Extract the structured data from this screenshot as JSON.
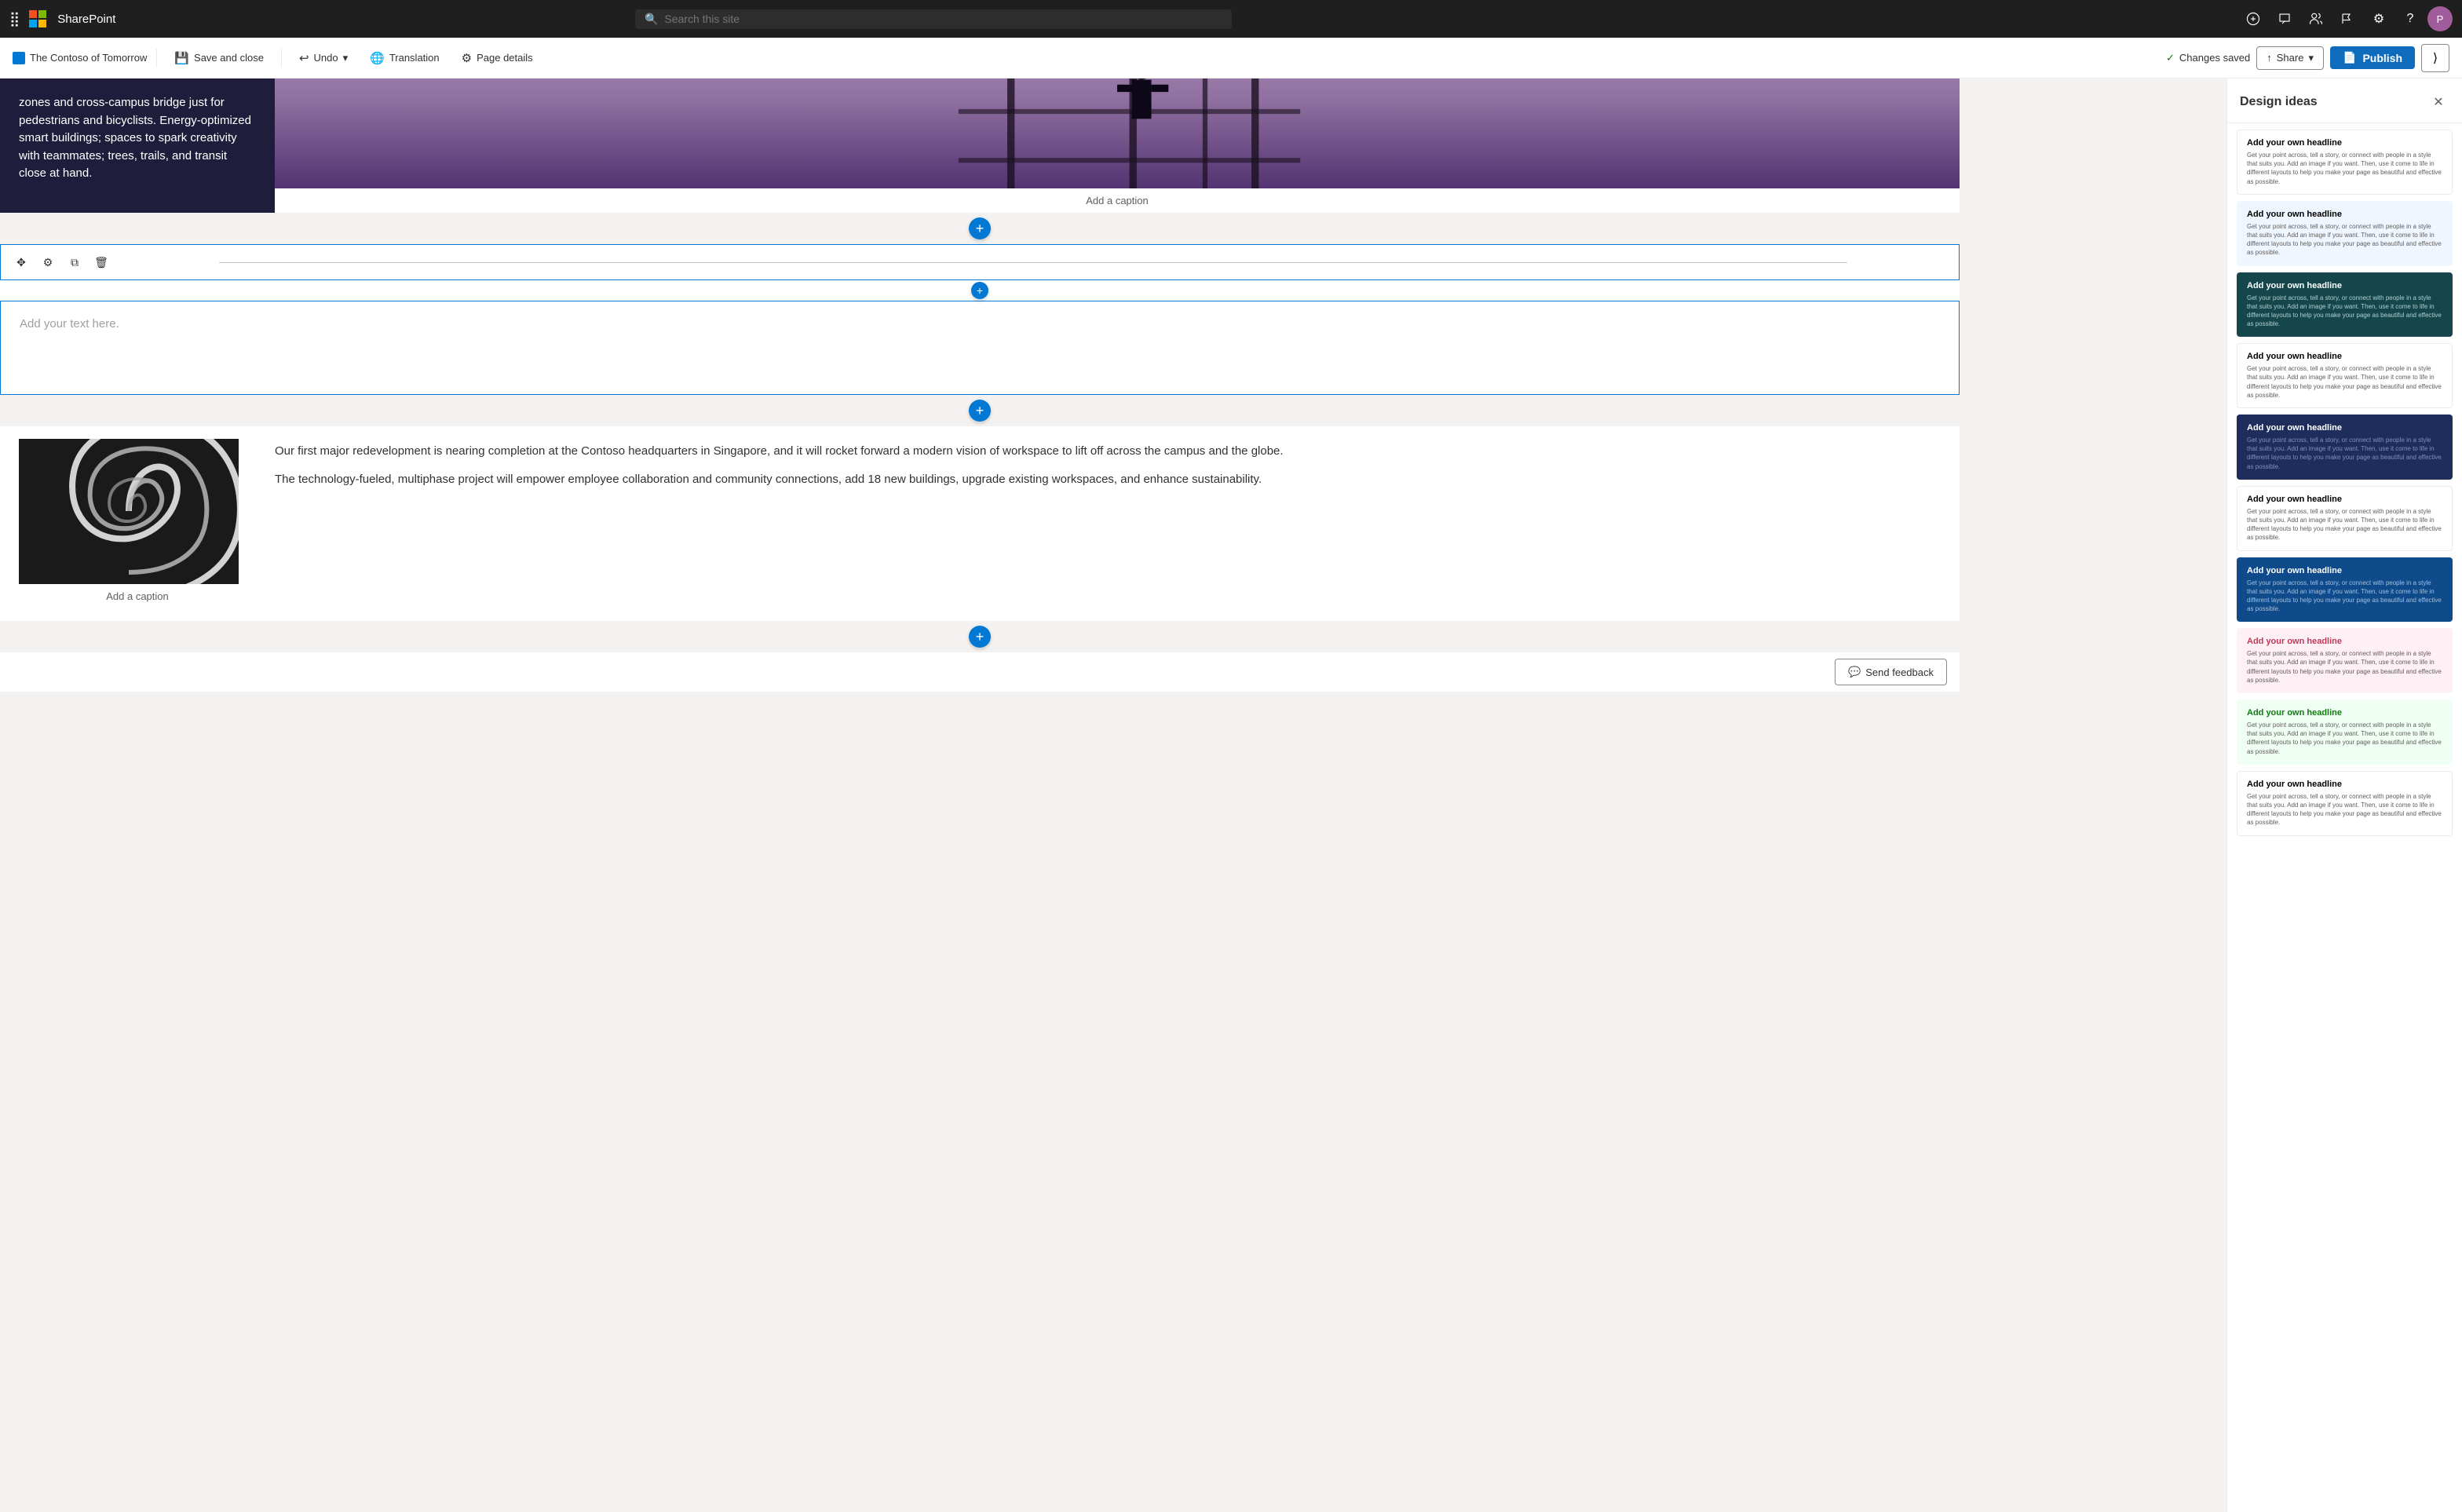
{
  "topnav": {
    "app_title": "SharePoint",
    "search_placeholder": "Search this site"
  },
  "toolbar": {
    "site_name": "The Contoso of Tomorrow",
    "save_close_label": "Save and close",
    "undo_label": "Undo",
    "translation_label": "Translation",
    "page_details_label": "Page details",
    "changes_saved_label": "Changes saved",
    "share_label": "Share",
    "publish_label": "Publish"
  },
  "design_panel": {
    "title": "Design ideas",
    "cards": [
      {
        "id": 1,
        "style": "style-white",
        "title": "Add your own headline",
        "text": "Get your point across, tell a story, or connect with people in a style that suits you. Add an image if you want. Then, use it come to life in different layouts to help you make your page as beautiful and effective as possible."
      },
      {
        "id": 2,
        "style": "style-light-blue",
        "title": "Add your own headline",
        "text": "Get your point across, tell a story, or connect with people in a style that suits you. Add an image if you want. Then, use it come to life in different layouts to help you make your page as beautiful and effective as possible."
      },
      {
        "id": 3,
        "style": "style-dark-teal",
        "title": "Add your own headline",
        "text": "Get your point across, tell a story, or connect with people in a style that suits you. Add an image if you want. Then, use it come to life in different layouts to help you make your page as beautiful and effective as possible."
      },
      {
        "id": 4,
        "style": "style-white2",
        "title": "Add your own headline",
        "text": "Get your point across, tell a story, or connect with people in a style that suits you. Add an image if you want. Then, use it come to life in different layouts to help you make your page as beautiful and effective as possible."
      },
      {
        "id": 5,
        "style": "style-dark-navy",
        "title": "Add your own headline",
        "text": "Get your point across, tell a story, or connect with people in a style that suits you. Add an image if you want. Then, use it come to life in different layouts to help you make your page as beautiful and effective as possible."
      },
      {
        "id": 6,
        "style": "style-white3",
        "title": "Add your own headline",
        "text": "Get your point across, tell a story, or connect with people in a style that suits you. Add an image if you want. Then, use it come to life in different layouts to help you make your page as beautiful and effective as possible."
      },
      {
        "id": 7,
        "style": "style-blue2",
        "title": "Add your own headline",
        "text": "Get your point across, tell a story, or connect with people in a style that suits you. Add an image if you want. Then, use it come to life in different layouts to help you make your page as beautiful and effective as possible."
      },
      {
        "id": 8,
        "style": "style-pink",
        "title": "Add your own headline",
        "text": "Get your point across, tell a story, or connect with people in a style that suits you. Add an image if you want. Then, use it come to life in different layouts to help you make your page as beautiful and effective as possible."
      },
      {
        "id": 9,
        "style": "style-green",
        "title": "Add your own headline",
        "text": "Get your point across, tell a story, or connect with people in a style that suits you. Add an image if you want. Then, use it come to life in different layouts to help you make your page as beautiful and effective as possible."
      },
      {
        "id": 10,
        "style": "style-white4",
        "title": "Add your own headline",
        "text": "Get your point across, tell a story, or connect with people in a style that suits you. Add an image if you want. Then, use it come to life in different layouts to help you make your page as beautiful and effective as possible."
      }
    ]
  },
  "page_content": {
    "top_text": "zones and cross-campus bridge just for pedestrians and bicyclists. Energy-optimized smart buildings; spaces to spark creativity with teammates; trees, trails, and transit close at hand.",
    "top_caption": "Add a caption",
    "divider_placeholder": "Add your text here.",
    "lower_caption": "Add a caption",
    "lower_para1": "Our first major redevelopment is nearing completion at the Contoso headquarters in Singapore, and it will rocket forward a modern vision of workspace to lift off across the campus and the globe.",
    "lower_para2": "The technology-fueled, multiphase project will empower employee collaboration and community connections, add 18 new buildings, upgrade existing workspaces, and enhance sustainability."
  },
  "feedback": {
    "label": "Send feedback"
  }
}
